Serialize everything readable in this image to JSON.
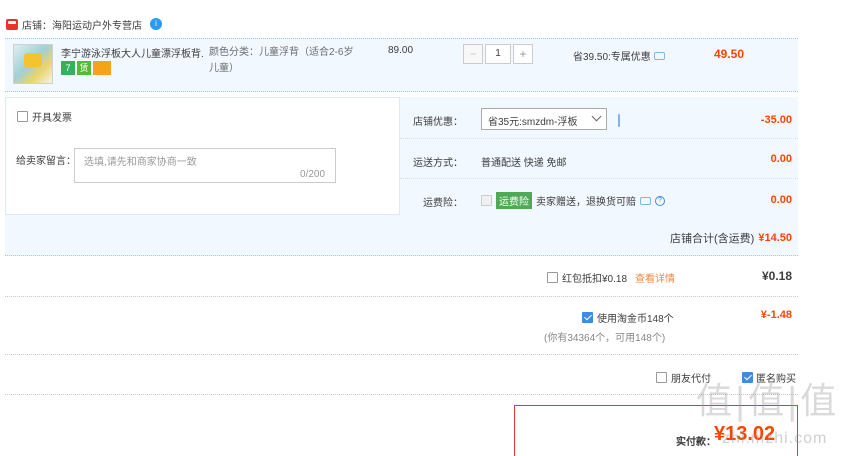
{
  "shop": {
    "label": "店铺：",
    "name": "海阳运动户外专营店",
    "info_icon": "i"
  },
  "item": {
    "title": "李宁游泳浮板大人儿童漂浮板背...",
    "tags": [
      "7",
      "赁"
    ],
    "spec_line1": "颜色分类：儿童浮背（适合2-6岁",
    "spec_line2": "儿童）",
    "unit_price": "89.00",
    "quantity": "1",
    "minus": "−",
    "plus": "+",
    "promo": "省39.50:专属优惠",
    "subtotal": "49.50"
  },
  "order": {
    "invoice_label": "开具发票",
    "message_label": "给卖家留言：",
    "message_placeholder": "选填,请先和商家协商一致",
    "message_count": "0/200",
    "discount_label": "店铺优惠：",
    "discount_value": "省35元:smzdm-浮板",
    "discount_amount": "-35.00",
    "shipping_label": "运送方式：",
    "shipping_value": "普通配送 快递 免邮",
    "shipping_amount": "0.00",
    "insurance_label": "运费险：",
    "insurance_tag": "运费险",
    "insurance_text": "卖家赠送，退换货可赔",
    "insurance_amount": "0.00",
    "shop_total_label": "店铺合计(含运费)",
    "shop_total": "¥14.50"
  },
  "redpacket": {
    "label": "红包抵扣¥0.18",
    "link": "查看详情",
    "amount": "¥0.18"
  },
  "coins": {
    "label": "使用淘金币148个",
    "note": "(你有34364个，可用148个)",
    "amount": "¥-1.48"
  },
  "options": {
    "friend_pay": "朋友代付",
    "anonymous": "匿名购买"
  },
  "payment": {
    "label": "实付款：",
    "amount": "¥13.02"
  },
  "watermark": {
    "logo": "值|值|值",
    "site": "zhi.mzhi.com"
  },
  "colors": {
    "accent_red": "#ff4400",
    "link_blue": "#3e8be0",
    "row_bg": "#f2f8ff"
  }
}
